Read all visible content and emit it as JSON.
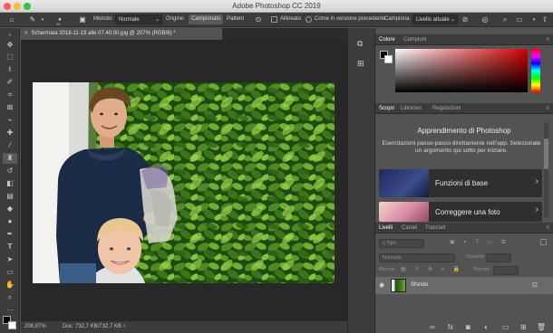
{
  "app": {
    "title": "Adobe Photoshop CC 2019"
  },
  "options_bar": {
    "mode_label": "Metodo:",
    "mode_value": "Normale",
    "brush_size": "19",
    "source_label": "Origine:",
    "source_sampled": "Campionato",
    "source_pattern": "Pattern",
    "aligned_label": "Allineato",
    "previous_version_label": "Come in versione precedente",
    "sample_label": "Campiona:",
    "sample_value": "Livello attuale"
  },
  "document": {
    "tab_title": "Schermata 2018-11-19 alle 07.40.00.jpg @ 207% (RGB/8) *"
  },
  "status_bar": {
    "zoom": "206,97%",
    "doc_info": "Doc: 732,7 KB/732,7 KB"
  },
  "color_panel": {
    "tabs": [
      "Colore",
      "Campioni"
    ],
    "accent": "#d40000"
  },
  "discover_panel": {
    "tabs": [
      "Scopri",
      "Libraries",
      "Regolazioni"
    ],
    "heading": "Apprendimento di Photoshop",
    "description": "Esercitazioni passo-passo direttamente nell'app. Selezionate un argomento qui sotto per iniziare.",
    "cards": [
      {
        "label": "Funzioni di base",
        "icon": "chevron-right-icon"
      },
      {
        "label": "Correggere una foto",
        "icon": "chevron-right-icon"
      }
    ]
  },
  "layers_panel": {
    "tabs": [
      "Livelli",
      "Canali",
      "Tracciati"
    ],
    "filter_label": "Tipo",
    "blend_mode": "Normale",
    "opacity_label": "Opacità:",
    "lock_label": "Blocca:",
    "fill_label": "Riempi:",
    "layers": [
      {
        "name": "Sfondo",
        "visible": true,
        "locked": true
      }
    ]
  }
}
